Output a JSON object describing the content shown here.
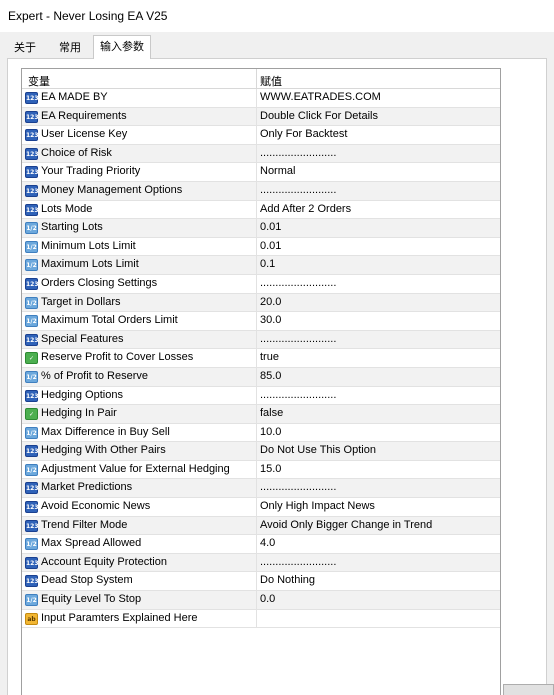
{
  "window": {
    "title": "Expert - Never Losing EA V25"
  },
  "tabs": [
    {
      "label": "关于",
      "active": false
    },
    {
      "label": "常用",
      "active": false
    },
    {
      "label": "输入参数",
      "active": true
    }
  ],
  "grid": {
    "columns": [
      "变量",
      "赋值"
    ],
    "rows": [
      {
        "name": "EA MADE BY",
        "value": "WWW.EATRADES.COM",
        "icon": "int-type-icon"
      },
      {
        "name": "EA Requirements",
        "value": "Double Click For Details",
        "icon": "int-type-icon"
      },
      {
        "name": "User License Key",
        "value": "Only For Backtest",
        "icon": "int-type-icon"
      },
      {
        "name": "Choice of Risk",
        "value": ".........................",
        "icon": "int-type-icon"
      },
      {
        "name": "Your Trading Priority",
        "value": "Normal",
        "icon": "int-type-icon"
      },
      {
        "name": "Money Management Options",
        "value": ".........................",
        "icon": "int-type-icon"
      },
      {
        "name": "Lots Mode",
        "value": "Add After 2 Orders",
        "icon": "int-type-icon"
      },
      {
        "name": "Starting Lots",
        "value": "0.01",
        "icon": "double-type-icon"
      },
      {
        "name": "Minimum Lots Limit",
        "value": "0.01",
        "icon": "double-type-icon"
      },
      {
        "name": "Maximum Lots Limit",
        "value": "0.1",
        "icon": "double-type-icon"
      },
      {
        "name": "Orders Closing Settings",
        "value": ".........................",
        "icon": "int-type-icon"
      },
      {
        "name": "Target in Dollars",
        "value": "20.0",
        "icon": "double-type-icon"
      },
      {
        "name": "Maximum Total Orders Limit",
        "value": "30.0",
        "icon": "double-type-icon"
      },
      {
        "name": "Special Features",
        "value": ".........................",
        "icon": "int-type-icon"
      },
      {
        "name": "Reserve Profit to Cover Losses",
        "value": "true",
        "icon": "bool-type-icon"
      },
      {
        "name": "% of Profit to Reserve",
        "value": "85.0",
        "icon": "double-type-icon"
      },
      {
        "name": "Hedging Options",
        "value": ".........................",
        "icon": "int-type-icon"
      },
      {
        "name": "Hedging In Pair",
        "value": "false",
        "icon": "bool-type-icon"
      },
      {
        "name": "Max Difference in Buy Sell",
        "value": "10.0",
        "icon": "double-type-icon"
      },
      {
        "name": "Hedging With Other Pairs",
        "value": "Do Not Use This Option",
        "icon": "int-type-icon"
      },
      {
        "name": "Adjustment Value for External Hedging",
        "value": "15.0",
        "icon": "double-type-icon"
      },
      {
        "name": "Market Predictions",
        "value": ".........................",
        "icon": "int-type-icon"
      },
      {
        "name": "Avoid Economic News",
        "value": "Only High Impact News",
        "icon": "int-type-icon"
      },
      {
        "name": "Trend Filter Mode",
        "value": "Avoid Only Bigger Change in Trend",
        "icon": "int-type-icon"
      },
      {
        "name": "Max Spread Allowed",
        "value": "4.0",
        "icon": "double-type-icon"
      },
      {
        "name": "Account Equity Protection",
        "value": ".........................",
        "icon": "int-type-icon"
      },
      {
        "name": "Dead Stop System",
        "value": "Do Nothing",
        "icon": "int-type-icon"
      },
      {
        "name": "Equity Level To Stop",
        "value": "0.0",
        "icon": "double-type-icon"
      },
      {
        "name": "Input Paramters Explained Here",
        "value": "",
        "icon": "string-type-icon"
      }
    ]
  },
  "icon_glyphs": {
    "int-type-icon": "123",
    "double-type-icon": "1/2",
    "bool-type-icon": "✓",
    "string-type-icon": "ab"
  },
  "icon_classes": {
    "int-type-icon": "int",
    "double-type-icon": "dbl",
    "bool-type-icon": "bool",
    "string-type-icon": "str"
  }
}
